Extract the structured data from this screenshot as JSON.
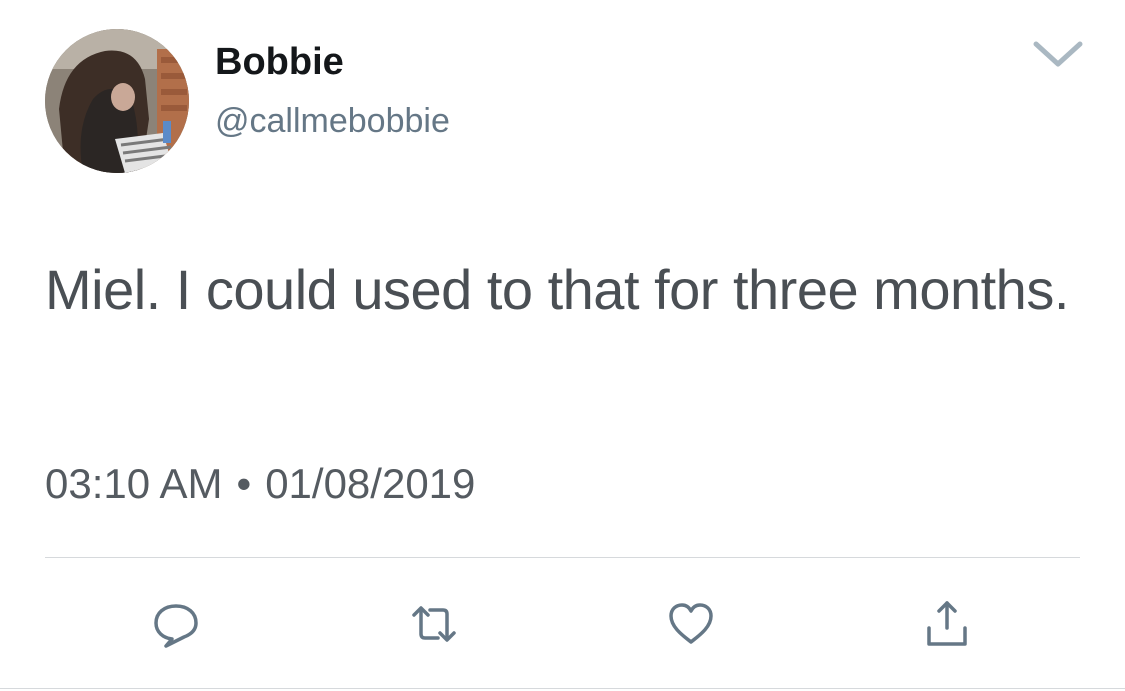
{
  "tweet": {
    "author": {
      "display_name": "Bobbie",
      "handle": "@callmebobbie",
      "avatar_icon": "profile-photo"
    },
    "text": "Miel. I could used to that for three months.",
    "time": "03:10 AM",
    "separator": "•",
    "date": "01/08/2019"
  },
  "actions": [
    {
      "name": "reply",
      "icon": "reply-icon"
    },
    {
      "name": "retweet",
      "icon": "retweet-icon"
    },
    {
      "name": "like",
      "icon": "heart-icon"
    },
    {
      "name": "share",
      "icon": "share-icon"
    }
  ],
  "menu": {
    "icon": "chevron-down-icon"
  },
  "colors": {
    "text_primary": "#14171a",
    "text_secondary": "#657786",
    "tweet_text": "#4a4f54",
    "icon_gray": "#657786",
    "divider": "#d6d9dc"
  }
}
